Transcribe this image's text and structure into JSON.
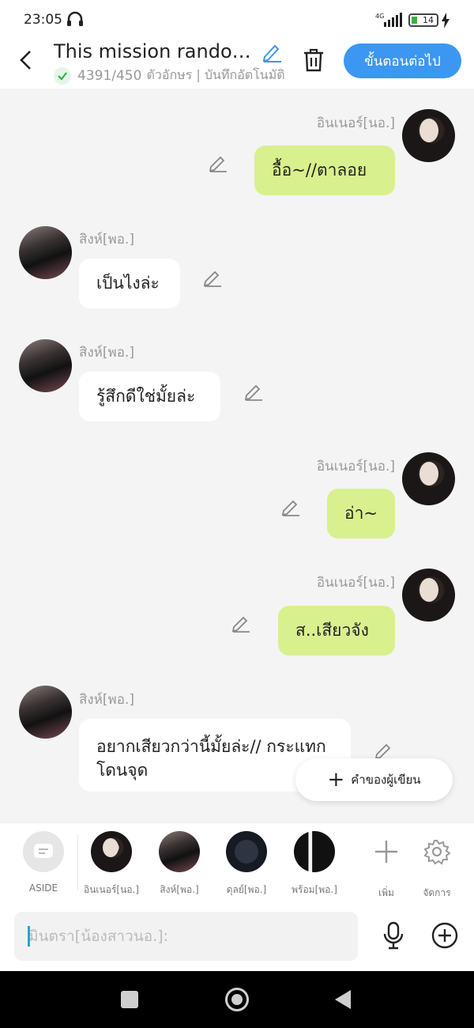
{
  "status_bar": {
    "time": "23:05",
    "network": "4G",
    "battery": "14"
  },
  "header": {
    "title": "This mission randoml...",
    "char_count": "4391/450",
    "meta": "ตัวอักษร | บันทึกอัตโนมัติ",
    "next_button": "ขั้นตอนต่อไป"
  },
  "messages": [
    {
      "sender": "อินเนอร์[นอ.]",
      "text": "อื้อ~//ตาลอย",
      "side": "right",
      "avatar": "a"
    },
    {
      "sender": "สิงห์[พอ.]",
      "text": "เป็นไงล่ะ",
      "side": "left",
      "avatar": "b"
    },
    {
      "sender": "สิงห์[พอ.]",
      "text": "รู้สึกดีใช่มั้ยล่ะ",
      "side": "left",
      "avatar": "b"
    },
    {
      "sender": "อินเนอร์[นอ.]",
      "text": "อ่า~",
      "side": "right",
      "avatar": "a"
    },
    {
      "sender": "อินเนอร์[นอ.]",
      "text": "ส..เสียวจัง",
      "side": "right",
      "avatar": "a"
    },
    {
      "sender": "สิงห์[พอ.]",
      "text": "อยากเสียวกว่านี้มั้ยล่ะ// กระแทกโดนจุด",
      "side": "left",
      "avatar": "b"
    }
  ],
  "fab_label": "คำของผู้เขียน",
  "characters": {
    "aside": "ASIDE",
    "items": [
      {
        "label": "อินเนอร์[นอ.]",
        "avatar": "a"
      },
      {
        "label": "สิงห์[พอ.]",
        "avatar": "b"
      },
      {
        "label": "ดุลย์[พอ.]",
        "avatar": "c"
      },
      {
        "label": "พร้อม[พอ.]",
        "avatar": "d"
      }
    ],
    "add_label": "เพิ่ม",
    "manage_label": "จัดการ"
  },
  "input": {
    "placeholder": "มินตรา[น้องสาวนอ.]:"
  }
}
